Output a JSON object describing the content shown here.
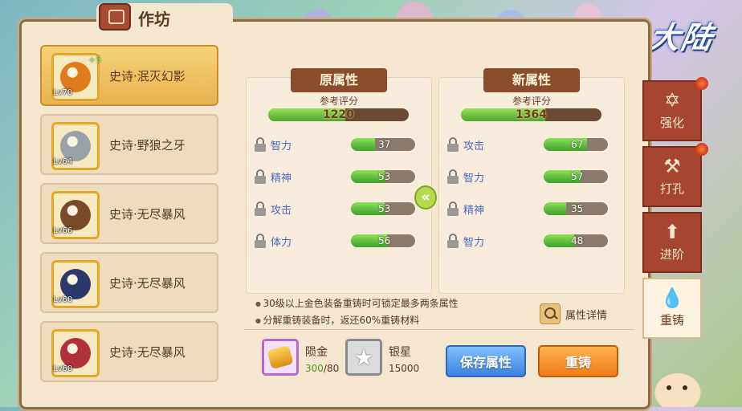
{
  "title": "作坊",
  "logo_text": "风之大陆",
  "items": [
    {
      "name": "史诗·泯灭幻影",
      "level": "Lv70",
      "plus": "+5",
      "color": "#e07a1a",
      "selected": true
    },
    {
      "name": "史诗·野狼之牙",
      "level": "Lv64",
      "plus": "",
      "color": "#9aa0a8",
      "selected": false
    },
    {
      "name": "史诗·无尽暴风",
      "level": "Lv66",
      "plus": "",
      "color": "#7a4a2a",
      "selected": false
    },
    {
      "name": "史诗·无尽暴风",
      "level": "Lv60",
      "plus": "",
      "color": "#2a3a6a",
      "selected": false
    },
    {
      "name": "史诗·无尽暴风",
      "level": "Lv60",
      "plus": "",
      "color": "#b0303a",
      "selected": false
    }
  ],
  "original": {
    "header": "原属性",
    "ref_label": "参考评分",
    "ref_value": "1220",
    "ref_fill": 0.55,
    "attrs": [
      {
        "name": "智力",
        "value": "37",
        "fill": 0.37
      },
      {
        "name": "精神",
        "value": "53",
        "fill": 0.53
      },
      {
        "name": "攻击",
        "value": "53",
        "fill": 0.53
      },
      {
        "name": "体力",
        "value": "56",
        "fill": 0.56
      }
    ]
  },
  "new": {
    "header": "新属性",
    "ref_label": "参考评分",
    "ref_value": "1364",
    "ref_fill": 0.6,
    "attrs": [
      {
        "name": "攻击",
        "value": "67",
        "fill": 0.67
      },
      {
        "name": "智力",
        "value": "57",
        "fill": 0.57
      },
      {
        "name": "精神",
        "value": "35",
        "fill": 0.35
      },
      {
        "name": "智力",
        "value": "48",
        "fill": 0.48
      }
    ]
  },
  "notes": [
    "30级以上金色装备重铸时可锁定最多两条属性",
    "分解重铸装备时，返还60%重铸材料"
  ],
  "detail_label": "属性详情",
  "materials": {
    "meteor": {
      "name": "陨金",
      "have": "300",
      "need": "/80"
    },
    "silver": {
      "name": "银星",
      "count": "15000"
    }
  },
  "buttons": {
    "save": "保存属性",
    "reforge": "重铸"
  },
  "tabs": [
    {
      "label": "强化",
      "icon": "✡",
      "active": false
    },
    {
      "label": "打孔",
      "icon": "⚒",
      "active": false
    },
    {
      "label": "进阶",
      "icon": "⬆",
      "active": false
    },
    {
      "label": "重铸",
      "icon": "💧",
      "active": true
    }
  ],
  "colors": {
    "accent_tab": "#a64530",
    "attr_label": "#4b6bbf",
    "bar_green": "#4fa72b"
  }
}
